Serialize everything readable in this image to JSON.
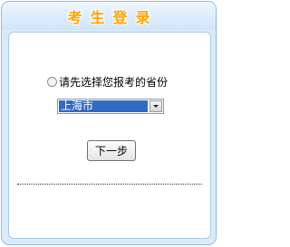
{
  "header": {
    "title": "考生登录"
  },
  "form": {
    "radio_label": "请先选择您报考的省份",
    "province_select": {
      "selected": "上海市"
    },
    "next_button": "下一步"
  },
  "colors": {
    "header_title": "#ffa200",
    "panel_border": "#8fbbe3",
    "panel_background": "#d9ebfb",
    "select_highlight": "#316ac5"
  }
}
